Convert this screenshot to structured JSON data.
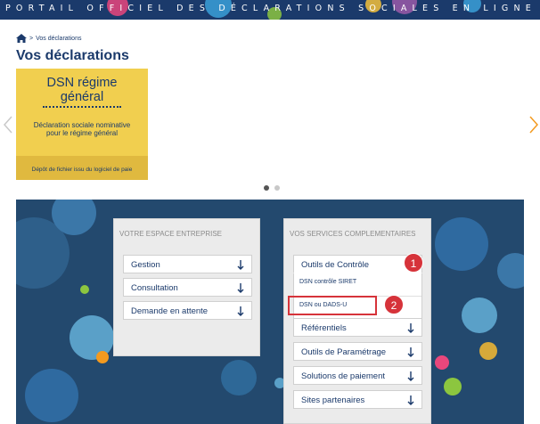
{
  "banner": {
    "text": "PORTAIL OFFICIEL DES DÉCLARATIONS SOCIALES EN LIGNE"
  },
  "breadcrumb": {
    "separator": ">",
    "current": "Vos déclarations"
  },
  "page_title": "Vos déclarations",
  "carousel": {
    "card": {
      "title_line1": "DSN régime",
      "title_line2": "général",
      "description_line1": "Déclaration sociale nominative",
      "description_line2": "pour le régime général",
      "footer": "Dépôt de fichier issu du logiciel de paie"
    }
  },
  "left_panel": {
    "header": "VOTRE ESPACE ENTREPRISE",
    "items": [
      {
        "label": "Gestion"
      },
      {
        "label": "Consultation"
      },
      {
        "label": "Demande en attente"
      }
    ]
  },
  "right_panel": {
    "header": "VOS SERVICES COMPLEMENTAIRES",
    "outils_controle": "Outils de Contrôle",
    "sub_items": [
      {
        "label": "DSN contrôle SIRET"
      },
      {
        "label": "DSN ou DADS-U"
      }
    ],
    "items": [
      {
        "label": "Référentiels"
      },
      {
        "label": "Outils de Paramétrage"
      },
      {
        "label": "Solutions de paiement"
      },
      {
        "label": "Sites partenaires"
      }
    ]
  },
  "annotations": {
    "badge1": "1",
    "badge2": "2"
  },
  "colors": {
    "navy": "#1b3a6b",
    "card_yellow": "#f1cf4f",
    "annotation_red": "#d6333a",
    "panel_grey": "#ebebeb"
  }
}
